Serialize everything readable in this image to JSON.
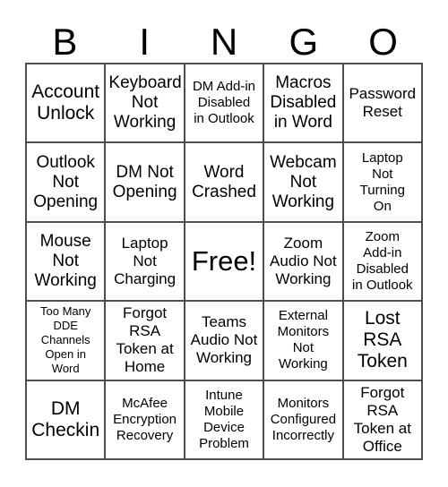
{
  "card": {
    "title": "BINGO",
    "header_letters": [
      "B",
      "I",
      "N",
      "G",
      "O"
    ],
    "grid_size": "5x5",
    "colors": {
      "border": "#4d4d4d",
      "text": "#000000",
      "background": "#ffffff"
    },
    "free_space": {
      "label": "Free!",
      "position": "center",
      "row": 3,
      "column": 3
    },
    "rows": [
      [
        {
          "text": "Account\nUnlock",
          "size": "lg"
        },
        {
          "text": "Keyboard\nNot\nWorking",
          "size": "md"
        },
        {
          "text": "DM Add-in\nDisabled\nin Outlook",
          "size": "xs"
        },
        {
          "text": "Macros\nDisabled\nin Word",
          "size": "md"
        },
        {
          "text": "Password\nReset",
          "size": "sm"
        }
      ],
      [
        {
          "text": "Outlook\nNot\nOpening",
          "size": "md"
        },
        {
          "text": "DM Not\nOpening",
          "size": "md"
        },
        {
          "text": "Word\nCrashed",
          "size": "md"
        },
        {
          "text": "Webcam\nNot\nWorking",
          "size": "md"
        },
        {
          "text": "Laptop\nNot\nTurning\nOn",
          "size": "xs"
        }
      ],
      [
        {
          "text": "Mouse\nNot\nWorking",
          "size": "md"
        },
        {
          "text": "Laptop\nNot\nCharging",
          "size": "sm"
        },
        {
          "text": "Free!",
          "size": "xl"
        },
        {
          "text": "Zoom\nAudio Not\nWorking",
          "size": "sm"
        },
        {
          "text": "Zoom\nAdd-in\nDisabled\nin Outlook",
          "size": "xs"
        }
      ],
      [
        {
          "text": "Too Many\nDDE\nChannels\nOpen in\nWord",
          "size": "xxs"
        },
        {
          "text": "Forgot\nRSA\nToken at\nHome",
          "size": "sm"
        },
        {
          "text": "Teams\nAudio Not\nWorking",
          "size": "sm"
        },
        {
          "text": "External\nMonitors\nNot\nWorking",
          "size": "xs"
        },
        {
          "text": "Lost\nRSA\nToken",
          "size": "lg"
        }
      ],
      [
        {
          "text": "DM\nCheckin",
          "size": "lg"
        },
        {
          "text": "McAfee\nEncryption\nRecovery",
          "size": "xs"
        },
        {
          "text": "Intune\nMobile\nDevice\nProblem",
          "size": "xs"
        },
        {
          "text": "Monitors\nConfigured\nIncorrectly",
          "size": "xs"
        },
        {
          "text": "Forgot\nRSA\nToken at\nOffice",
          "size": "sm"
        }
      ]
    ]
  }
}
